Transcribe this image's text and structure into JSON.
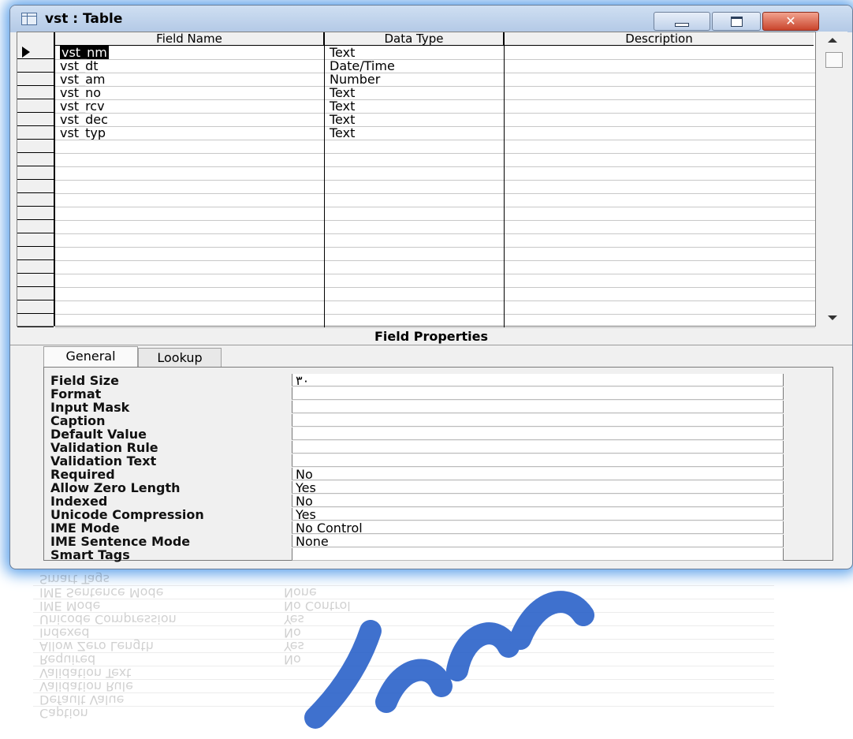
{
  "window": {
    "title": "vst : Table",
    "accent": "#5ea2ea"
  },
  "grid": {
    "headers": {
      "field_name": "Field Name",
      "data_type": "Data Type",
      "description": "Description"
    },
    "rows": [
      {
        "field": "vst_nm",
        "type": "Text",
        "desc": "",
        "selected": true
      },
      {
        "field": "vst_dt",
        "type": "Date/Time",
        "desc": ""
      },
      {
        "field": "vst_am",
        "type": "Number",
        "desc": ""
      },
      {
        "field": "vst_no",
        "type": "Text",
        "desc": ""
      },
      {
        "field": "vst_rcv",
        "type": "Text",
        "desc": ""
      },
      {
        "field": "vst_dec",
        "type": "Text",
        "desc": ""
      },
      {
        "field": "vst_typ",
        "type": "Text",
        "desc": ""
      }
    ]
  },
  "field_properties": {
    "title": "Field Properties",
    "tabs": [
      {
        "label": "General",
        "active": true
      },
      {
        "label": "Lookup",
        "active": false
      }
    ],
    "properties": [
      {
        "label": "Field Size",
        "value": "۳۰"
      },
      {
        "label": "Format",
        "value": ""
      },
      {
        "label": "Input Mask",
        "value": ""
      },
      {
        "label": "Caption",
        "value": ""
      },
      {
        "label": "Default Value",
        "value": ""
      },
      {
        "label": "Validation Rule",
        "value": ""
      },
      {
        "label": "Validation Text",
        "value": ""
      },
      {
        "label": "Required",
        "value": "No"
      },
      {
        "label": "Allow Zero Length",
        "value": "Yes"
      },
      {
        "label": "Indexed",
        "value": "No"
      },
      {
        "label": "Unicode Compression",
        "value": "Yes"
      },
      {
        "label": "IME Mode",
        "value": "No Control"
      },
      {
        "label": "IME Sentence Mode",
        "value": "None"
      },
      {
        "label": "Smart Tags",
        "value": ""
      }
    ]
  }
}
